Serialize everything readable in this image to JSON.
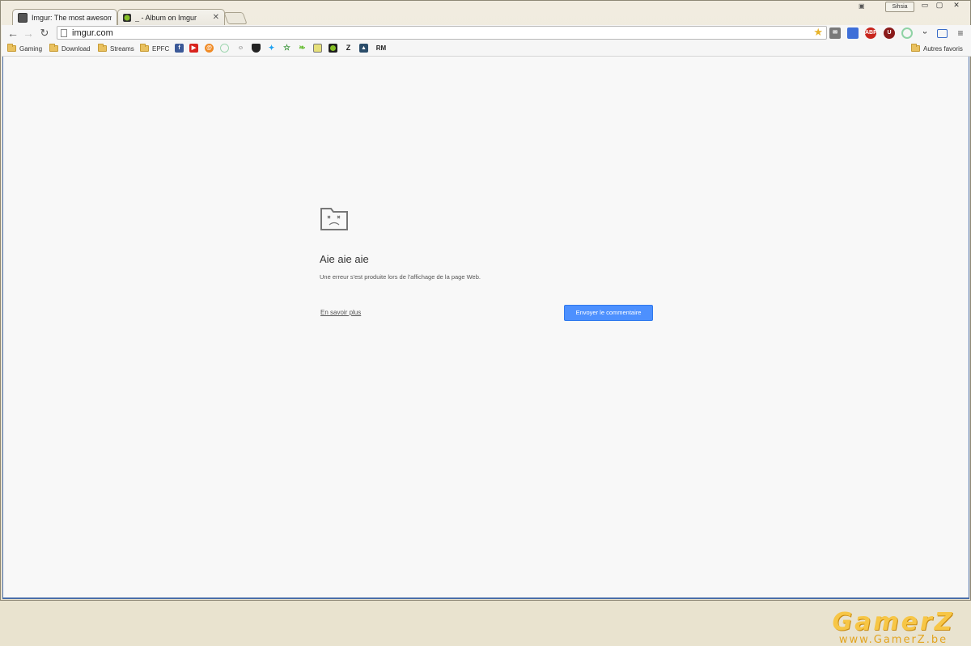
{
  "tabs": [
    {
      "label": "Imgur: The most awesome",
      "active": true
    },
    {
      "label": "_ - Album on Imgur",
      "active": false
    }
  ],
  "window": {
    "profile_label": "Sihsia"
  },
  "toolbar": {
    "url": "imgur.com"
  },
  "extensions": [
    {
      "name": "mail-icon"
    },
    {
      "name": "calendar-icon"
    },
    {
      "name": "adblock-icon",
      "text": "ABP"
    },
    {
      "name": "ublock-icon",
      "text": "U"
    },
    {
      "name": "loading-icon"
    },
    {
      "name": "smile-icon"
    },
    {
      "name": "fullscreen-icon"
    },
    {
      "name": "menu-icon"
    }
  ],
  "bookmarks": {
    "folders": [
      "Gaming",
      "Download",
      "Streams",
      "EPFC"
    ],
    "other_label": "Autres favoris",
    "icons": [
      "facebook-icon",
      "youtube-icon",
      "orange-icon",
      "circle-icon",
      "reddit-icon",
      "shield-icon",
      "twitter-icon",
      "star-icon",
      "leaf-icon",
      "smiley-icon",
      "green-icon",
      "z-icon",
      "mountain-icon",
      "rm-icon"
    ]
  },
  "error": {
    "title": "Aie aie aie",
    "message": "Une erreur s'est produite lors de l'affichage de la page Web.",
    "learn_more": "En savoir plus",
    "feedback_button": "Envoyer le commentaire"
  },
  "watermark": {
    "logo": "GamerZ",
    "url": "www.GamerZ.be"
  }
}
